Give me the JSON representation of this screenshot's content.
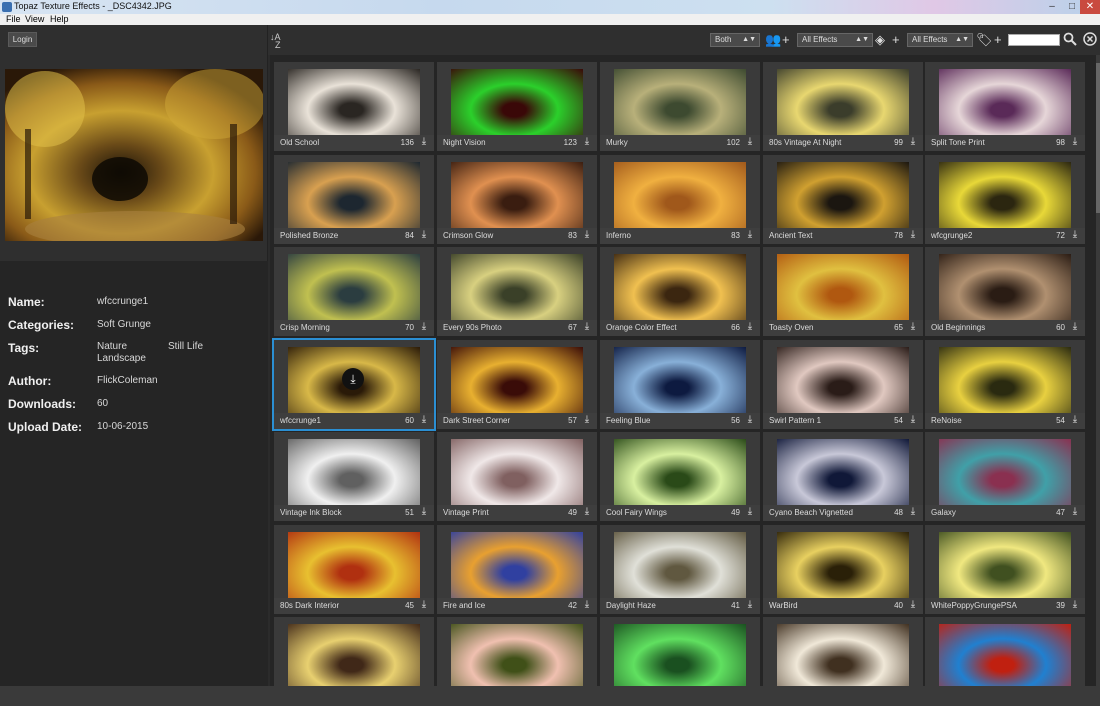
{
  "window": {
    "title": "Topaz Texture Effects - _DSC4342.JPG",
    "controls": [
      "–",
      "□",
      "✕"
    ]
  },
  "menu": [
    "File",
    "View",
    "Help"
  ],
  "left": {
    "login_label": "Login",
    "info": {
      "name_label": "Name:",
      "name": "wfccrunge1",
      "categories_label": "Categories:",
      "categories": "Soft Grunge",
      "tags_label": "Tags:",
      "tags": [
        "Nature",
        "Still Life",
        "Landscape"
      ],
      "author_label": "Author:",
      "author": "FlickColeman",
      "downloads_label": "Downloads:",
      "downloads": "60",
      "upload_label": "Upload Date:",
      "upload_date": "10-06-2015"
    }
  },
  "toolbar": {
    "sort_icon": "sort-az-icon",
    "filter_both": "Both",
    "filter_effects1": "All Effects",
    "filter_effects2": "All Effects",
    "search_placeholder": ""
  },
  "grid": [
    {
      "name": "Old School",
      "count": "136",
      "tint": [
        "#e9e2d8",
        "#2a2622"
      ]
    },
    {
      "name": "Night Vision",
      "count": "123",
      "tint": [
        "#2bd02b",
        "#3a0808"
      ]
    },
    {
      "name": "Murky",
      "count": "102",
      "tint": [
        "#b8b07a",
        "#3d4a30"
      ]
    },
    {
      "name": "80s Vintage At Night",
      "count": "99",
      "tint": [
        "#e8d770",
        "#3b3d2b"
      ]
    },
    {
      "name": "Split Tone Print",
      "count": "98",
      "tint": [
        "#e6d6d8",
        "#5a2a58"
      ]
    },
    {
      "name": "Polished Bronze",
      "count": "84",
      "tint": [
        "#d8a050",
        "#1d2730"
      ]
    },
    {
      "name": "Crimson Glow",
      "count": "83",
      "tint": [
        "#e09050",
        "#3a1d10"
      ]
    },
    {
      "name": "Inferno",
      "count": "83",
      "tint": [
        "#f0b040",
        "#a0581b"
      ]
    },
    {
      "name": "Ancient Text",
      "count": "78",
      "tint": [
        "#d0a030",
        "#1b1610"
      ]
    },
    {
      "name": "wfcgrunge2",
      "count": "72",
      "tint": [
        "#e8d838",
        "#2b2610"
      ]
    },
    {
      "name": "Crisp Morning",
      "count": "70",
      "tint": [
        "#c0c050",
        "#2b3d40"
      ]
    },
    {
      "name": "Every 90s Photo",
      "count": "67",
      "tint": [
        "#d8d080",
        "#3a4028"
      ]
    },
    {
      "name": "Orange Color Effect",
      "count": "66",
      "tint": [
        "#f0c050",
        "#3b2610"
      ]
    },
    {
      "name": "Toasty Oven",
      "count": "65",
      "tint": [
        "#e0c040",
        "#b05810"
      ]
    },
    {
      "name": "Old Beginnings",
      "count": "60",
      "tint": [
        "#b09070",
        "#2a1c14"
      ]
    },
    {
      "name": "wfccrunge1",
      "count": "60",
      "tint": [
        "#d8b848",
        "#2a1a08"
      ],
      "selected": true
    },
    {
      "name": "Dark Street Corner",
      "count": "57",
      "tint": [
        "#e8b030",
        "#3a0c08"
      ]
    },
    {
      "name": "Feeling Blue",
      "count": "56",
      "tint": [
        "#88b0d8",
        "#0d1a40"
      ]
    },
    {
      "name": "Swirl Pattern 1",
      "count": "54",
      "tint": [
        "#e0c8c0",
        "#2a1c18"
      ]
    },
    {
      "name": "ReNoise",
      "count": "54",
      "tint": [
        "#e8d040",
        "#2a2a10"
      ]
    },
    {
      "name": "Vintage Ink Block",
      "count": "51",
      "tint": [
        "#f0f0f0",
        "#606060"
      ]
    },
    {
      "name": "Vintage Print",
      "count": "49",
      "tint": [
        "#f0e8e8",
        "#806060"
      ]
    },
    {
      "name": "Cool Fairy Wings",
      "count": "49",
      "tint": [
        "#d8f0a0",
        "#2a4a18"
      ]
    },
    {
      "name": "Cyano Beach Vignetted",
      "count": "48",
      "tint": [
        "#c8c8d8",
        "#101838"
      ]
    },
    {
      "name": "Galaxy",
      "count": "47",
      "tint": [
        "#40a0a8",
        "#8a3050"
      ]
    },
    {
      "name": "80s Dark Interior",
      "count": "45",
      "tint": [
        "#e8c030",
        "#b03010"
      ]
    },
    {
      "name": "Fire and Ice",
      "count": "42",
      "tint": [
        "#e8a030",
        "#3040a0"
      ]
    },
    {
      "name": "Daylight Haze",
      "count": "41",
      "tint": [
        "#e0e0d8",
        "#605840"
      ]
    },
    {
      "name": "WarBird",
      "count": "40",
      "tint": [
        "#e8d060",
        "#2a2008"
      ]
    },
    {
      "name": "WhitePoppyGrungePSA",
      "count": "39",
      "tint": [
        "#f0e880",
        "#405020"
      ]
    },
    {
      "name": "",
      "count": "",
      "tint": [
        "#e8d070",
        "#402818"
      ]
    },
    {
      "name": "",
      "count": "",
      "tint": [
        "#f0c0b0",
        "#405018"
      ]
    },
    {
      "name": "",
      "count": "",
      "tint": [
        "#60e060",
        "#1a5020"
      ]
    },
    {
      "name": "",
      "count": "",
      "tint": [
        "#f0e8d8",
        "#403020"
      ]
    },
    {
      "name": "",
      "count": "",
      "tint": [
        "#2080d0",
        "#c02010"
      ]
    }
  ]
}
